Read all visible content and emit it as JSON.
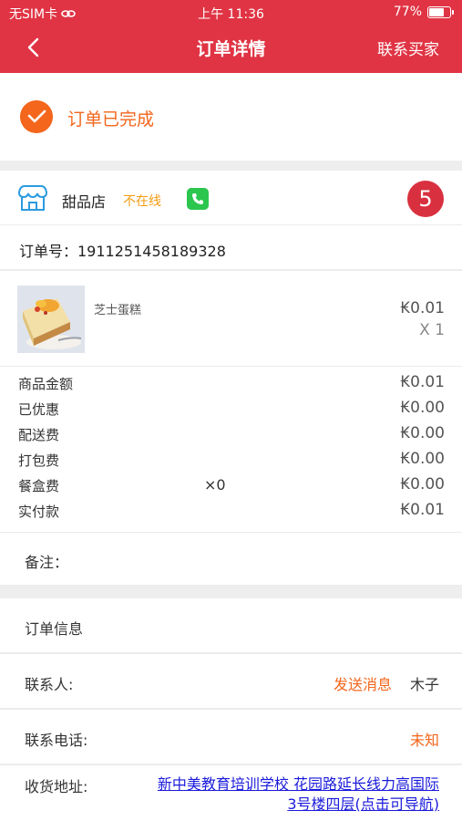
{
  "status_bar": {
    "carrier": "无SIM卡",
    "time": "上午 11:36",
    "battery": "77%",
    "battery_level": 0.77
  },
  "nav": {
    "title": "订单详情",
    "contact_seller": "联系买家"
  },
  "order_status": {
    "text": "订单已完成",
    "color": "#f3661c"
  },
  "shop": {
    "name": "甜品店",
    "online_status": "不在线",
    "badge": "5"
  },
  "order_number": "订单号：1911251458189328",
  "product": {
    "name": "芝士蛋糕",
    "price": "₭0.01",
    "quantity": "X 1"
  },
  "fees": [
    {
      "label": "商品金额",
      "mid": "",
      "value": "₭0.01"
    },
    {
      "label": "已优惠",
      "mid": "",
      "value": "₭0.00"
    },
    {
      "label": "配送费",
      "mid": "",
      "value": "₭0.00"
    },
    {
      "label": "打包费",
      "mid": "",
      "value": "₭0.00"
    },
    {
      "label": "餐盒费",
      "mid": "×0",
      "value": "₭0.00"
    },
    {
      "label": "实付款",
      "mid": "",
      "value": "₭0.01"
    }
  ],
  "remark": {
    "label": "备注："
  },
  "order_info": {
    "title": "订单信息",
    "contact_label": "联系人:",
    "send_message": "发送消息",
    "contact_name": "木子",
    "phone_label": "联系电话:",
    "phone_value": "未知",
    "address_label": "收货地址:",
    "address_line1": "新中美教育培训学校 花园路延长线力高国际",
    "address_line2": "3号楼四层(点击可导航)"
  },
  "colors": {
    "header": "#e03444",
    "accent": "#f3661c",
    "badge": "#d9303f",
    "link": "#1a1adb"
  }
}
